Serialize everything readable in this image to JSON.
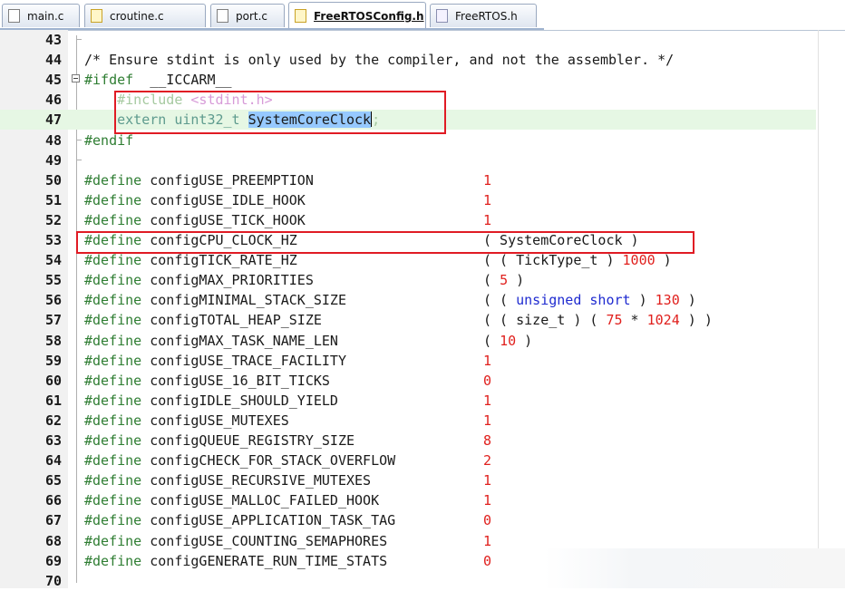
{
  "tabs": [
    {
      "label": "main.c",
      "icon": "c-file-icon",
      "active": false
    },
    {
      "label": "croutine.c",
      "icon": "c-file-icon",
      "active": false
    },
    {
      "label": "port.c",
      "icon": "c-file-icon",
      "active": false
    },
    {
      "label": "FreeRTOSConfig.h",
      "icon": "header-file-icon",
      "active": true
    },
    {
      "label": "FreeRTOS.h",
      "icon": "header-file-icon",
      "active": false
    }
  ],
  "lines": [
    {
      "n": "43"
    },
    {
      "n": "44",
      "comment": "/* Ensure stdint is only used by the compiler, and not the assembler. */"
    },
    {
      "n": "45",
      "pp": "#ifdef",
      "rest": "  __ICCARM__"
    },
    {
      "n": "46",
      "inc": "#include",
      "incfile": " <stdint.h>"
    },
    {
      "n": "47",
      "ext": "extern uint32_t ",
      "sel": "SystemCoreClock",
      "tail": ";"
    },
    {
      "n": "48",
      "pp": "#endif"
    },
    {
      "n": "49"
    },
    {
      "n": "50",
      "name": "configUSE_PREEMPTION",
      "val": "1"
    },
    {
      "n": "51",
      "name": "configUSE_IDLE_HOOK",
      "val": "1"
    },
    {
      "n": "52",
      "name": "configUSE_TICK_HOOK",
      "val": "1"
    },
    {
      "n": "53",
      "name": "configCPU_CLOCK_HZ",
      "val": "( SystemCoreClock )"
    },
    {
      "n": "54",
      "name": "configTICK_RATE_HZ",
      "val": "( ( TickType_t ) 1000 )"
    },
    {
      "n": "55",
      "name": "configMAX_PRIORITIES",
      "val": "( 5 )"
    },
    {
      "n": "56",
      "name": "configMINIMAL_STACK_SIZE",
      "val": "( ( unsigned short ) 130 )"
    },
    {
      "n": "57",
      "name": "configTOTAL_HEAP_SIZE",
      "val": "( ( size_t ) ( 75 * 1024 ) )"
    },
    {
      "n": "58",
      "name": "configMAX_TASK_NAME_LEN",
      "val": "( 10 )"
    },
    {
      "n": "59",
      "name": "configUSE_TRACE_FACILITY",
      "val": "1"
    },
    {
      "n": "60",
      "name": "configUSE_16_BIT_TICKS",
      "val": "0"
    },
    {
      "n": "61",
      "name": "configIDLE_SHOULD_YIELD",
      "val": "1"
    },
    {
      "n": "62",
      "name": "configUSE_MUTEXES",
      "val": "1"
    },
    {
      "n": "63",
      "name": "configQUEUE_REGISTRY_SIZE",
      "val": "8"
    },
    {
      "n": "64",
      "name": "configCHECK_FOR_STACK_OVERFLOW",
      "val": "2"
    },
    {
      "n": "65",
      "name": "configUSE_RECURSIVE_MUTEXES",
      "val": "1"
    },
    {
      "n": "66",
      "name": "configUSE_MALLOC_FAILED_HOOK",
      "val": "1"
    },
    {
      "n": "67",
      "name": "configUSE_APPLICATION_TASK_TAG",
      "val": "0"
    },
    {
      "n": "68",
      "name": "configUSE_COUNTING_SEMAPHORES",
      "val": "1"
    },
    {
      "n": "69",
      "name": "configGENERATE_RUN_TIME_STATS",
      "val": "0"
    },
    {
      "n": "70"
    }
  ],
  "define_kw": "#define",
  "highlight_color": "#e01b24",
  "selection_color": "#96c9ff"
}
